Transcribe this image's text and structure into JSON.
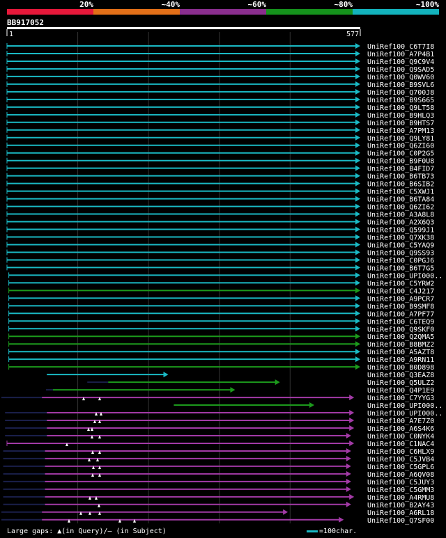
{
  "legend": {
    "labels": [
      "20%",
      "~40%",
      "~60%",
      "~80%",
      "~100%"
    ],
    "colors": [
      "#e6183a",
      "#e26f18",
      "#8a2e8e",
      "#15921c",
      "#13b3bd"
    ]
  },
  "query": {
    "title": "BB917052",
    "start": "1",
    "end": "577",
    "length": 577
  },
  "footer": {
    "gaps_text": "Large gaps: ▲(in Query)/– (in Subject)",
    "scale_text": "=100char."
  },
  "colors": {
    "cyan": "#1ab9c4",
    "green": "#1c9a1c",
    "purple": "#a23aa6",
    "navy": "#1a1f4a",
    "axis": "#ffffff"
  },
  "hits": [
    {
      "name": "UniRef100_C6T7I8",
      "start": 1,
      "end": 577,
      "color": "cyan"
    },
    {
      "name": "UniRef100_A7P4B1",
      "start": 1,
      "end": 577,
      "color": "cyan"
    },
    {
      "name": "UniRef100_Q9C9V4",
      "start": 1,
      "end": 577,
      "color": "cyan"
    },
    {
      "name": "UniRef100_Q9SAD5",
      "start": 1,
      "end": 577,
      "color": "cyan"
    },
    {
      "name": "UniRef100_Q0WV60",
      "start": 1,
      "end": 577,
      "color": "cyan"
    },
    {
      "name": "UniRef100_B9SVL6",
      "start": 1,
      "end": 577,
      "color": "cyan"
    },
    {
      "name": "UniRef100_Q700J8",
      "start": 1,
      "end": 577,
      "color": "cyan"
    },
    {
      "name": "UniRef100_B9S665",
      "start": 1,
      "end": 577,
      "color": "cyan"
    },
    {
      "name": "UniRef100_Q9LT58",
      "start": 1,
      "end": 577,
      "color": "cyan"
    },
    {
      "name": "UniRef100_B9HLQ3",
      "start": 1,
      "end": 577,
      "color": "cyan"
    },
    {
      "name": "UniRef100_B9HTS7",
      "start": 1,
      "end": 577,
      "color": "cyan"
    },
    {
      "name": "UniRef100_A7PM13",
      "start": 1,
      "end": 577,
      "color": "cyan"
    },
    {
      "name": "UniRef100_Q9LY81",
      "start": 1,
      "end": 577,
      "color": "cyan"
    },
    {
      "name": "UniRef100_Q6ZI60",
      "start": 1,
      "end": 577,
      "color": "cyan"
    },
    {
      "name": "UniRef100_C0P2G5",
      "start": 1,
      "end": 577,
      "color": "cyan"
    },
    {
      "name": "UniRef100_B9F0U8",
      "start": 1,
      "end": 577,
      "color": "cyan"
    },
    {
      "name": "UniRef100_B4FID7",
      "start": 1,
      "end": 577,
      "color": "cyan"
    },
    {
      "name": "UniRef100_B6TB73",
      "start": 1,
      "end": 577,
      "color": "cyan"
    },
    {
      "name": "UniRef100_B6SIB2",
      "start": 1,
      "end": 577,
      "color": "cyan"
    },
    {
      "name": "UniRef100_C5XWJ1",
      "start": 1,
      "end": 577,
      "color": "cyan"
    },
    {
      "name": "UniRef100_B6TA84",
      "start": 1,
      "end": 577,
      "color": "cyan"
    },
    {
      "name": "UniRef100_Q6ZI62",
      "start": 1,
      "end": 577,
      "color": "cyan"
    },
    {
      "name": "UniRef100_A3A8L8",
      "start": 1,
      "end": 577,
      "color": "cyan"
    },
    {
      "name": "UniRef100_A2X6Q3",
      "start": 1,
      "end": 577,
      "color": "cyan"
    },
    {
      "name": "UniRef100_Q599J1",
      "start": 1,
      "end": 577,
      "color": "cyan"
    },
    {
      "name": "UniRef100_Q7XK38",
      "start": 1,
      "end": 577,
      "color": "cyan"
    },
    {
      "name": "UniRef100_C5YAQ9",
      "start": 1,
      "end": 577,
      "color": "cyan"
    },
    {
      "name": "UniRef100_Q9SS93",
      "start": 1,
      "end": 577,
      "color": "cyan"
    },
    {
      "name": "UniRef100_C0PGJ6",
      "start": 1,
      "end": 577,
      "color": "cyan"
    },
    {
      "name": "UniRef100_B6T7G5",
      "start": 1,
      "end": 577,
      "color": "cyan"
    },
    {
      "name": "UniRef100_UPI000..",
      "start": 4,
      "end": 577,
      "color": "cyan"
    },
    {
      "name": "UniRef100_C5YRW2",
      "start": 4,
      "end": 577,
      "color": "cyan"
    },
    {
      "name": "UniRef100_C4J217",
      "start": 4,
      "end": 577,
      "color": "green"
    },
    {
      "name": "UniRef100_A9PCR7",
      "start": 4,
      "end": 577,
      "color": "cyan"
    },
    {
      "name": "UniRef100_B9SMF8",
      "start": 4,
      "end": 577,
      "color": "cyan"
    },
    {
      "name": "UniRef100_A7PF77",
      "start": 4,
      "end": 577,
      "color": "cyan"
    },
    {
      "name": "UniRef100_C6TEQ9",
      "start": 4,
      "end": 577,
      "color": "cyan"
    },
    {
      "name": "UniRef100_Q9SKF0",
      "start": 4,
      "end": 577,
      "color": "cyan"
    },
    {
      "name": "UniRef100_Q2QMA5",
      "start": 4,
      "end": 577,
      "color": "green"
    },
    {
      "name": "UniRef100_B8BMZ2",
      "start": 4,
      "end": 577,
      "color": "green"
    },
    {
      "name": "UniRef100_A5AZT8",
      "start": 4,
      "end": 577,
      "color": "cyan"
    },
    {
      "name": "UniRef100_A9RN11",
      "start": 4,
      "end": 577,
      "color": "cyan"
    },
    {
      "name": "UniRef100_B0D898",
      "start": 4,
      "end": 577,
      "color": "green"
    },
    {
      "name": "UniRef100_Q3EAZ8",
      "start": 66,
      "end": 264,
      "color": "cyan"
    },
    {
      "name": "UniRef100_Q5ULZ2",
      "start": 166,
      "end": 446,
      "color": "green",
      "pre": -30
    },
    {
      "name": "UniRef100_Q4P1E9",
      "start": 76,
      "end": 373,
      "color": "green",
      "pre": -10
    },
    {
      "name": "UniRef100_C7YYG3",
      "start": 58,
      "end": 567,
      "color": "purple",
      "pre": -60,
      "gaps": [
        110,
        133
      ]
    },
    {
      "name": "UniRef100_UPI000..",
      "start": 273,
      "end": 502,
      "color": "green"
    },
    {
      "name": "UniRef100_UPI000..",
      "start": 66,
      "end": 567,
      "color": "purple",
      "pre": -60,
      "gaps": [
        128,
        135
      ]
    },
    {
      "name": "UniRef100_A7E7Z0",
      "start": 66,
      "end": 567,
      "color": "purple",
      "pre": -60,
      "gaps": [
        126,
        133
      ]
    },
    {
      "name": "UniRef100_A6S4K6",
      "start": 66,
      "end": 567,
      "color": "purple",
      "pre": -60,
      "gaps": [
        117,
        122
      ]
    },
    {
      "name": "UniRef100_C0NYK4",
      "start": 66,
      "end": 562,
      "color": "purple",
      "pre": -60,
      "gaps": [
        122,
        133
      ]
    },
    {
      "name": "UniRef100_C1NAC4",
      "start": 1,
      "end": 567,
      "color": "purple",
      "gaps": [
        86
      ]
    },
    {
      "name": "UniRef100_C6HLX9",
      "start": 63,
      "end": 562,
      "color": "purple",
      "pre": -60,
      "gaps": [
        123,
        133
      ]
    },
    {
      "name": "UniRef100_C5JVB4",
      "start": 63,
      "end": 562,
      "color": "purple",
      "pre": -60,
      "gaps": [
        118,
        130
      ]
    },
    {
      "name": "UniRef100_C5GPL6",
      "start": 63,
      "end": 562,
      "color": "purple",
      "pre": -60,
      "gaps": [
        124,
        133
      ]
    },
    {
      "name": "UniRef100_A6QV08",
      "start": 63,
      "end": 562,
      "color": "purple",
      "pre": -60,
      "gaps": [
        123,
        133
      ]
    },
    {
      "name": "UniRef100_C5JUY3",
      "start": 63,
      "end": 562,
      "color": "purple",
      "pre": -60
    },
    {
      "name": "UniRef100_C5GMM3",
      "start": 63,
      "end": 562,
      "color": "purple",
      "pre": -60
    },
    {
      "name": "UniRef100_A4RMU8",
      "start": 63,
      "end": 567,
      "color": "purple",
      "pre": -60,
      "gaps": [
        119,
        128
      ]
    },
    {
      "name": "UniRef100_B2AY43",
      "start": 63,
      "end": 562,
      "color": "purple",
      "pre": -60,
      "gaps": [
        132
      ]
    },
    {
      "name": "UniRef100_A6RL18",
      "start": 58,
      "end": 459,
      "color": "purple",
      "pre": -60,
      "gaps": [
        106,
        119,
        133
      ]
    },
    {
      "name": "UniRef100_Q7SF00",
      "start": 58,
      "end": 550,
      "color": "purple",
      "pre": -60,
      "gaps": [
        89,
        162,
        183
      ]
    }
  ]
}
